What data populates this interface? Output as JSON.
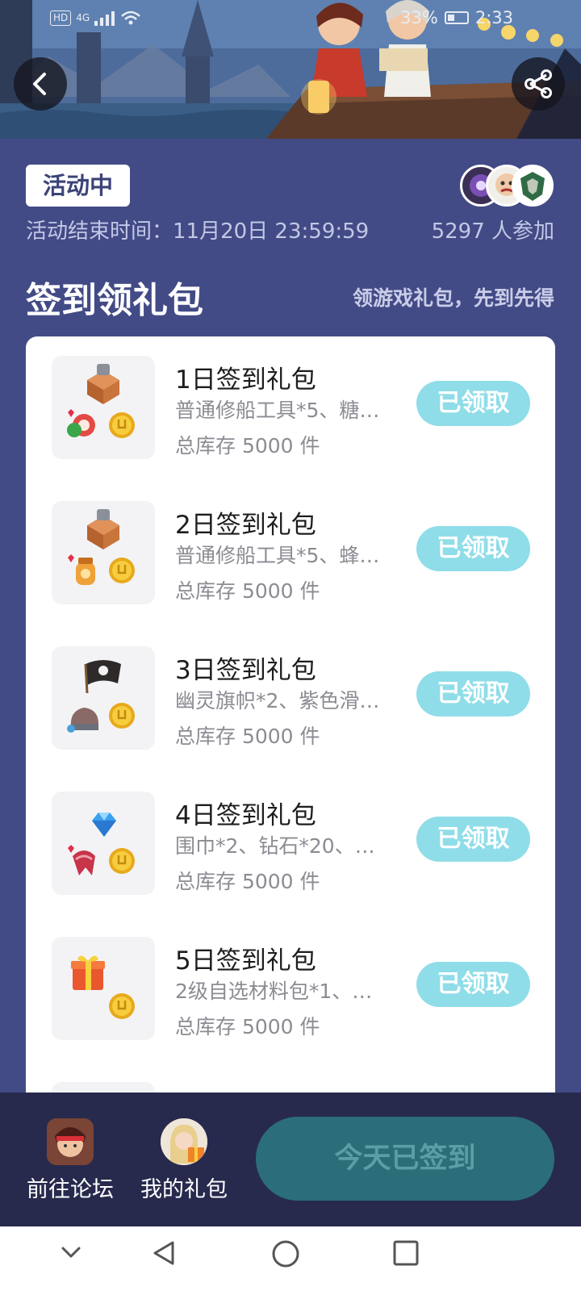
{
  "status_bar": {
    "hd_label": "HD",
    "signal_label": "4G",
    "battery_percent": "33%",
    "time": "2:33"
  },
  "header": {
    "back_icon": "chevron-left-icon",
    "share_icon": "share-icon"
  },
  "activity": {
    "status_tag": "活动中",
    "end_time": "活动结束时间：11月20日 23:59:59",
    "participants": "5297 人参加"
  },
  "section": {
    "title": "签到领礼包",
    "subtitle": "领游戏礼包，先到先得"
  },
  "gifts": [
    {
      "title": "1日签到礼包",
      "desc": "普通修船工具*5、糖…",
      "stock": "总库存 5000 件",
      "button": "已领取",
      "icons": [
        "toolbox-icon",
        "candy-icon",
        "gold-coin-icon"
      ]
    },
    {
      "title": "2日签到礼包",
      "desc": "普通修船工具*5、蜂…",
      "stock": "总库存 5000 件",
      "button": "已领取",
      "icons": [
        "toolbox-icon",
        "honey-jar-icon",
        "gold-coin-icon"
      ]
    },
    {
      "title": "3日签到礼包",
      "desc": "幽灵旗帜*2、紫色滑…",
      "stock": "总库存 5000 件",
      "button": "已领取",
      "icons": [
        "pirate-flag-icon",
        "ship-part-icon",
        "gold-coin-icon"
      ]
    },
    {
      "title": "4日签到礼包",
      "desc": "围巾*2、钻石*20、…",
      "stock": "总库存 5000 件",
      "button": "已领取",
      "icons": [
        "diamond-icon",
        "scarf-icon",
        "gold-coin-icon"
      ]
    },
    {
      "title": "5日签到礼包",
      "desc": "2级自选材料包*1、…",
      "stock": "总库存 5000 件",
      "button": "已领取",
      "icons": [
        "gift-box-icon",
        "gold-coin-icon"
      ]
    }
  ],
  "bottom_bar": {
    "forum_label": "前往论坛",
    "my_gifts_label": "我的礼包",
    "signin_button": "今天已签到"
  },
  "colors": {
    "page_bg": "#434b86",
    "claimed_button": "#8fdde8",
    "signin_button_bg": "#2b6e79",
    "bottom_bar_bg": "#272a4d"
  }
}
